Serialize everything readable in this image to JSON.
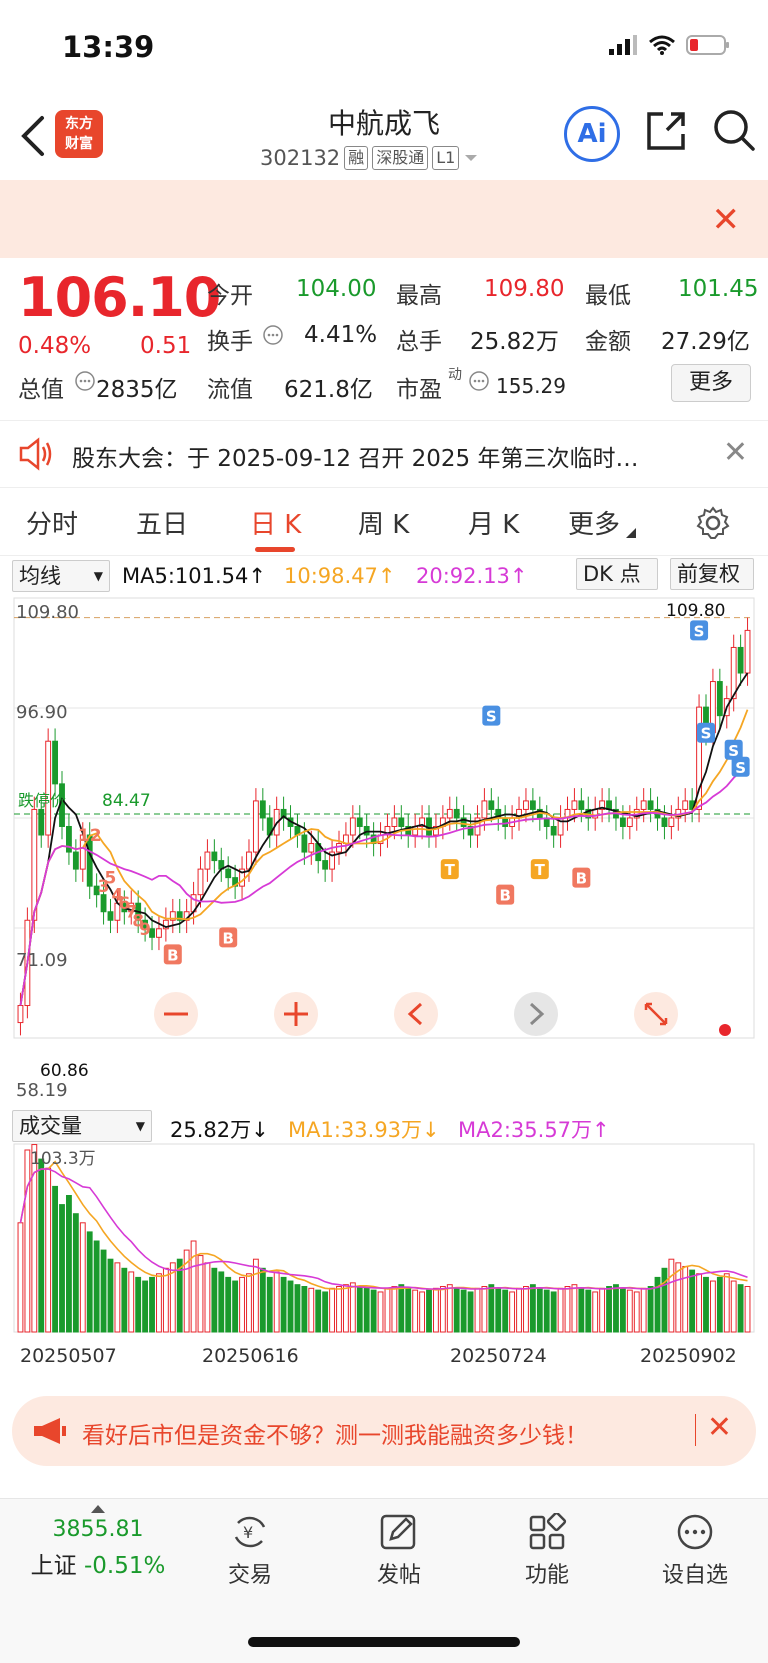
{
  "status_bar": {
    "time": "13:39"
  },
  "header": {
    "logo_line1": "东方",
    "logo_line2": "财富",
    "stock_name": "中航成飞",
    "stock_code": "302132",
    "tags": [
      "融",
      "深股通",
      "L1"
    ],
    "ai_label": "Ai"
  },
  "quote": {
    "price": "106.10",
    "pct_change": "0.48%",
    "change": "0.51",
    "open_label": "今开",
    "open": "104.00",
    "high_label": "最高",
    "high": "109.80",
    "low_label": "最低",
    "low": "101.45",
    "turnover_label": "换手",
    "turnover": "4.41%",
    "volume_label": "总手",
    "volume": "25.82万",
    "amount_label": "金额",
    "amount": "27.29亿",
    "mktcap_label": "总值",
    "mktcap": "2835亿",
    "float_label": "流值",
    "float": "621.8亿",
    "pe_label": "市盈",
    "pe_sup": "动",
    "pe": "155.29",
    "more_label": "更多"
  },
  "announcement": {
    "text": "股东大会：于 2025-09-12 召开 2025 年第三次临时…"
  },
  "tabs": [
    {
      "label": "分时"
    },
    {
      "label": "五日"
    },
    {
      "label": "日 K"
    },
    {
      "label": "周 K"
    },
    {
      "label": "月 K"
    },
    {
      "label": "更多"
    }
  ],
  "ma_legend": {
    "selector": "均线",
    "ma5": "MA5:101.54↑",
    "ma10": "10:98.47↑",
    "ma20": "20:92.13↑",
    "dk_button": "DK 点",
    "fq_button": "前复权"
  },
  "volume_legend": {
    "selector": "成交量",
    "current": "25.82万↓",
    "ma1": "MA1:33.93万↓",
    "ma2": "MA2:35.57万↑"
  },
  "promo": {
    "text": "看好后市但是资金不够？测一测我能融资多少钱！"
  },
  "bottom_nav": {
    "index_value": "3855.81",
    "index_name": "上证",
    "index_change": "-0.51%",
    "items": [
      "交易",
      "发帖",
      "功能",
      "设自选"
    ]
  },
  "colors": {
    "up": "#e8262c",
    "down": "#1a9a2c",
    "ma5": "#111111",
    "ma10": "#f5a623",
    "ma20": "#d63ad6",
    "accent": "#e8462c"
  },
  "chart_data": [
    {
      "type": "candlestick",
      "y_ticks": [
        "109.80",
        "96.90",
        "84.00",
        "71.09",
        "58.19"
      ],
      "ylim": [
        58.19,
        109.8
      ],
      "high_mark": "109.80",
      "low_mark": "60.86",
      "current_line_label": "84.47",
      "current_line_prefix": "跌停价",
      "x_ticks": [
        "20250507",
        "20250616",
        "20250724",
        "20250902"
      ],
      "signal_labels": [
        "S",
        "S",
        "S",
        "S",
        "S",
        "B",
        "B",
        "B",
        "B",
        "T",
        "T",
        "12",
        "3",
        "5",
        "4",
        "6",
        "7",
        "8",
        "9"
      ],
      "closes": [
        62,
        72,
        85,
        82,
        93,
        88,
        83,
        80,
        78,
        82,
        76,
        75,
        73,
        72,
        74,
        73,
        74,
        72,
        71,
        70,
        71,
        72,
        73,
        72,
        73,
        75,
        78,
        80,
        79,
        78,
        77,
        76,
        78,
        80,
        86,
        84,
        82,
        85,
        84,
        83,
        82,
        80,
        81,
        79,
        78,
        80,
        81,
        82,
        84,
        83,
        82,
        81,
        82,
        83,
        84,
        83,
        82,
        83,
        84,
        82,
        83,
        84,
        85,
        84,
        83,
        82,
        84,
        86,
        85,
        84,
        83,
        84,
        85,
        86,
        85,
        84,
        83,
        82,
        84,
        85,
        86,
        85,
        84,
        85,
        86,
        85,
        84,
        83,
        84,
        85,
        86,
        85,
        84,
        83,
        84,
        85,
        86,
        85,
        97,
        94,
        100,
        96,
        98,
        104,
        101,
        106
      ],
      "series": [
        {
          "name": "MA5"
        },
        {
          "name": "10"
        },
        {
          "name": "20"
        }
      ]
    },
    {
      "type": "bar",
      "title": "成交量",
      "y_top_label": "103.3万",
      "volumes": [
        60,
        100,
        103,
        95,
        90,
        80,
        70,
        75,
        65,
        60,
        55,
        50,
        45,
        40,
        38,
        35,
        33,
        30,
        28,
        30,
        32,
        35,
        38,
        40,
        45,
        50,
        42,
        38,
        35,
        33,
        30,
        28,
        30,
        32,
        40,
        35,
        30,
        33,
        30,
        28,
        26,
        25,
        24,
        23,
        22,
        24,
        25,
        26,
        27,
        25,
        24,
        23,
        22,
        24,
        25,
        26,
        24,
        23,
        22,
        23,
        24,
        25,
        26,
        24,
        23,
        22,
        24,
        25,
        26,
        24,
        23,
        22,
        24,
        25,
        26,
        24,
        23,
        22,
        24,
        25,
        26,
        24,
        23,
        22,
        24,
        25,
        26,
        24,
        23,
        22,
        24,
        25,
        30,
        35,
        40,
        38,
        36,
        34,
        32,
        30,
        28,
        30,
        32,
        28,
        26,
        25
      ]
    }
  ]
}
